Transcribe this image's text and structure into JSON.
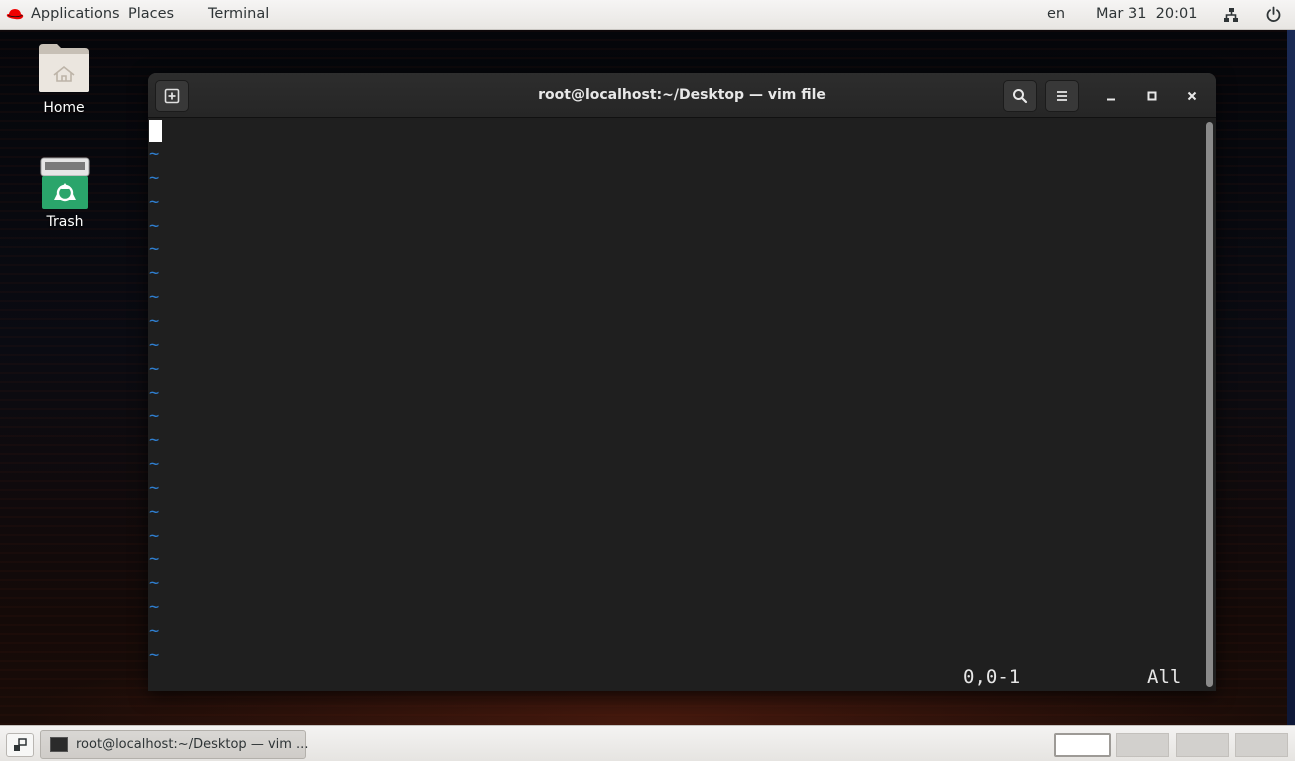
{
  "topbar": {
    "applications": "Applications",
    "places": "Places",
    "terminal": "Terminal",
    "language": "en",
    "datetime": "Mar 31  20:01",
    "icons": [
      "redhat-logo-icon",
      "network-icon",
      "power-icon"
    ]
  },
  "desktop": {
    "home_label": "Home",
    "trash_label": "Trash"
  },
  "window": {
    "title": "root@localhost:~/Desktop — vim file",
    "icons": [
      "new-tab-icon",
      "search-icon",
      "menu-icon",
      "minimize-icon",
      "maximize-icon",
      "close-icon"
    ]
  },
  "vim": {
    "tilde_char": "~",
    "tilde_count": 22,
    "cursor_position": "0,0-1",
    "scroll_indicator": "All"
  },
  "taskbar": {
    "task_label": "root@localhost:~/Desktop — vim ...",
    "workspaces": 4,
    "active_workspace": 1
  },
  "colors": {
    "terminal_bg": "#1f1f1f",
    "tilde_blue": "#2f7fd0",
    "redhat_red": "#ee0000",
    "trash_green": "#2aa56b"
  }
}
